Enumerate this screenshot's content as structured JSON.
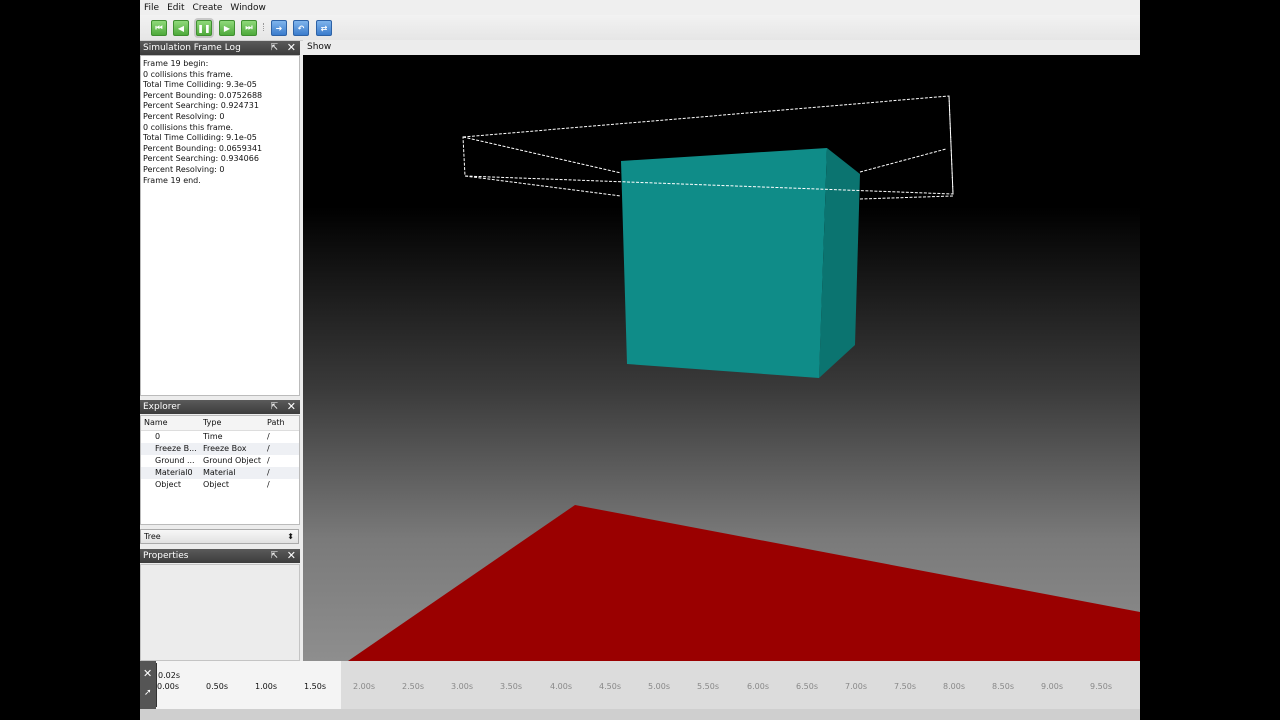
{
  "menu": [
    "File",
    "Edit",
    "Create",
    "Window"
  ],
  "toolbar": {
    "buttons": [
      {
        "name": "skip-to-start-icon",
        "glyph": "⏮",
        "color": "green"
      },
      {
        "name": "step-back-icon",
        "glyph": "◀",
        "color": "green"
      },
      {
        "name": "pause-icon",
        "glyph": "❚❚",
        "color": "green"
      },
      {
        "name": "step-forward-icon",
        "glyph": "▶",
        "color": "green"
      },
      {
        "name": "skip-to-end-icon",
        "glyph": "⏭",
        "color": "green"
      },
      {
        "name": "forward-arrow-icon",
        "glyph": "➜",
        "color": "blue"
      },
      {
        "name": "undo-arrow-icon",
        "glyph": "↶",
        "color": "blue"
      },
      {
        "name": "swap-arrow-icon",
        "glyph": "⇄",
        "color": "blue"
      }
    ]
  },
  "frame_log": {
    "title": "Simulation Frame Log",
    "lines": [
      "Frame 19 begin:",
      "0 collisions this frame.",
      "Total Time Colliding: 9.3e-05",
      "Percent Bounding: 0.0752688",
      "Percent Searching: 0.924731",
      "Percent Resolving: 0",
      "0 collisions this frame.",
      "Total Time Colliding: 9.1e-05",
      "Percent Bounding: 0.0659341",
      "Percent Searching: 0.934066",
      "Percent Resolving: 0",
      "Frame 19 end."
    ]
  },
  "explorer": {
    "title": "Explorer",
    "columns": [
      "Name",
      "Type",
      "Path"
    ],
    "rows": [
      {
        "name": "0",
        "type": "Time",
        "path": "/"
      },
      {
        "name": "Freeze B...",
        "type": "Freeze Box",
        "path": "/"
      },
      {
        "name": "Ground ...",
        "type": "Ground Object",
        "path": "/"
      },
      {
        "name": "Material0",
        "type": "Material",
        "path": "/"
      },
      {
        "name": "Object",
        "type": "Object",
        "path": "/"
      }
    ],
    "view_mode": "Tree"
  },
  "properties": {
    "title": "Properties"
  },
  "viewport": {
    "show_label": "Show",
    "colors": {
      "cube": "#0e8a86",
      "ground": "#9a0000",
      "wireframe": "#ffffff"
    }
  },
  "timeline": {
    "current": "0.02s",
    "ticks": [
      "0.00s",
      "0.50s",
      "1.00s",
      "1.50s",
      "2.00s",
      "2.50s",
      "3.00s",
      "3.50s",
      "4.00s",
      "4.50s",
      "5.00s",
      "5.50s",
      "6.00s",
      "6.50s",
      "7.00s",
      "7.50s",
      "8.00s",
      "8.50s",
      "9.00s",
      "9.50s"
    ]
  }
}
